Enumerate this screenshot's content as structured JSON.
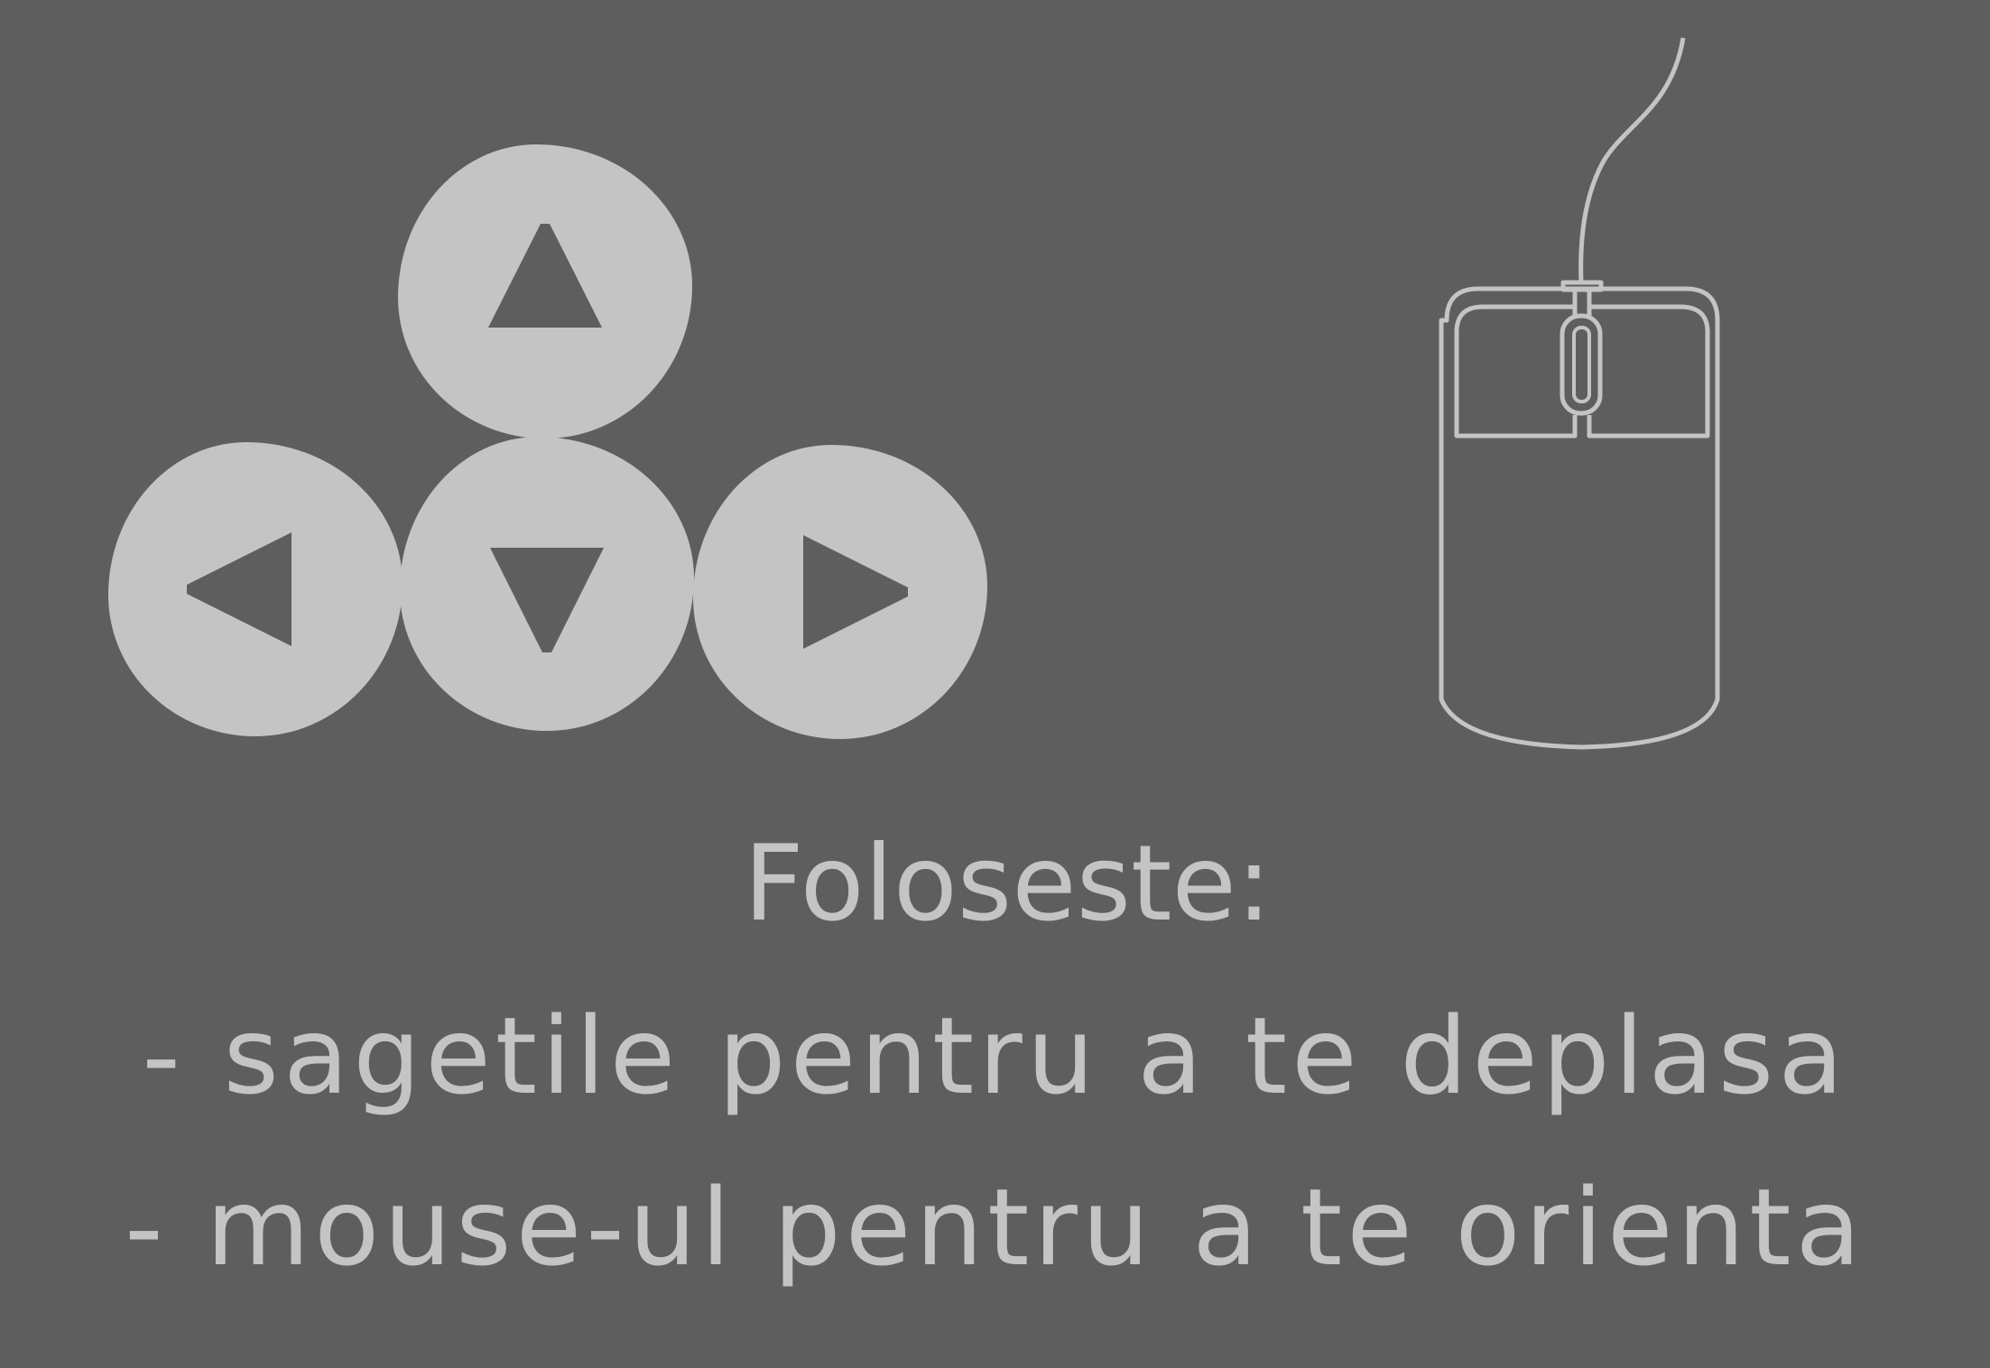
{
  "colors": {
    "background": "#5e5e5e",
    "foreground": "#c4c4c4"
  },
  "controls": {
    "arrow_keys": [
      {
        "name": "up",
        "icon": "arrow-up-icon"
      },
      {
        "name": "left",
        "icon": "arrow-left-icon"
      },
      {
        "name": "down",
        "icon": "arrow-down-icon"
      },
      {
        "name": "right",
        "icon": "arrow-right-icon"
      }
    ],
    "mouse_icon": "mouse-icon"
  },
  "instructions": {
    "title": "Foloseste:",
    "lines": [
      "- sagetile pentru a te deplasa",
      "- mouse-ul pentru a te orienta"
    ]
  }
}
